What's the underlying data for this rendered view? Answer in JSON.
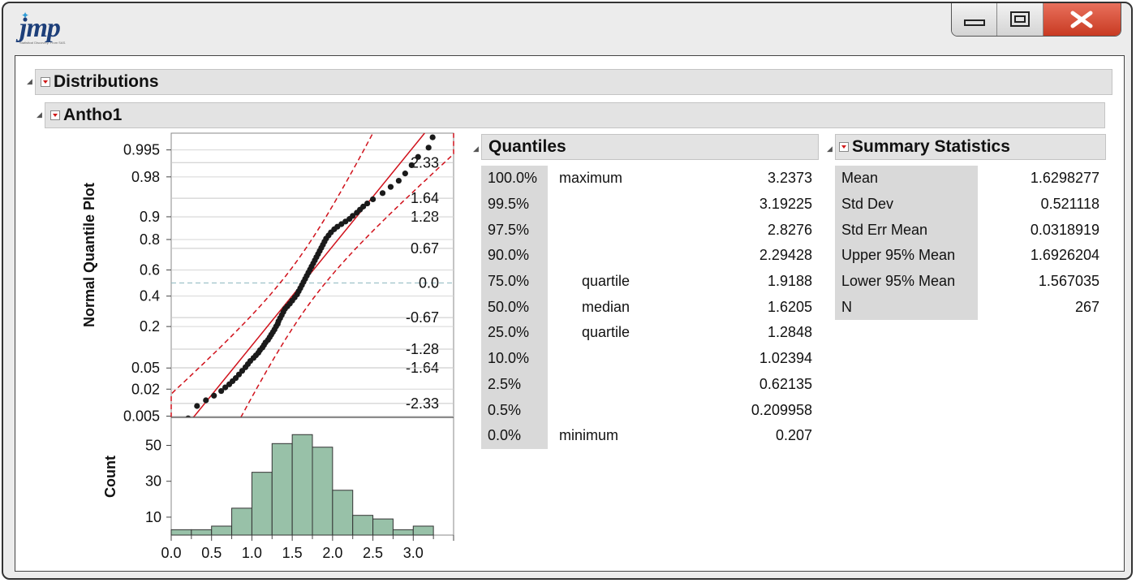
{
  "app": {
    "logo_text": "jmp",
    "logo_subtext": "Statistical Discovery. From SAS."
  },
  "window": {
    "controls": [
      "minimize",
      "maximize",
      "close"
    ]
  },
  "report": {
    "title": "Distributions",
    "variable": "Antho1",
    "quantiles": {
      "title": "Quantiles",
      "rows": [
        {
          "pct": "100.0%",
          "label": "maximum",
          "value": "3.2373"
        },
        {
          "pct": "99.5%",
          "label": "",
          "value": "3.19225"
        },
        {
          "pct": "97.5%",
          "label": "",
          "value": "2.8276"
        },
        {
          "pct": "90.0%",
          "label": "",
          "value": "2.29428"
        },
        {
          "pct": "75.0%",
          "label": "quartile",
          "value": "1.9188"
        },
        {
          "pct": "50.0%",
          "label": "median",
          "value": "1.6205"
        },
        {
          "pct": "25.0%",
          "label": "quartile",
          "value": "1.2848"
        },
        {
          "pct": "10.0%",
          "label": "",
          "value": "1.02394"
        },
        {
          "pct": "2.5%",
          "label": "",
          "value": "0.62135"
        },
        {
          "pct": "0.5%",
          "label": "",
          "value": "0.209958"
        },
        {
          "pct": "0.0%",
          "label": "minimum",
          "value": "0.207"
        }
      ]
    },
    "summary": {
      "title": "Summary Statistics",
      "rows": [
        {
          "label": "Mean",
          "value": "1.6298277"
        },
        {
          "label": "Std Dev",
          "value": "0.521118"
        },
        {
          "label": "Std Err Mean",
          "value": "0.0318919"
        },
        {
          "label": "Upper 95% Mean",
          "value": "1.6926204"
        },
        {
          "label": "Lower 95% Mean",
          "value": "1.567035"
        },
        {
          "label": "N",
          "value": "267"
        }
      ]
    }
  },
  "colors": {
    "bar_fill": "#98c1a8",
    "fit_line": "#d0111b",
    "points": "#1a1a1a",
    "header_bg": "#e3e3e3",
    "label_bg": "#d9d9d9"
  },
  "chart_data": [
    {
      "type": "scatter",
      "title": "",
      "ylabel": "Normal Quantile Plot",
      "left_ticks": [
        "0.995",
        "0.98",
        "0.9",
        "0.8",
        "0.6",
        "0.4",
        "0.2",
        "0.05",
        "0.02",
        "0.005"
      ],
      "right_ticks": [
        "2.33",
        "1.64",
        "1.28",
        "0.67",
        "0.0",
        "-0.67",
        "-1.28",
        "-1.64",
        "-2.33"
      ],
      "right_tick_values": [
        2.33,
        1.64,
        1.28,
        0.67,
        0.0,
        -0.67,
        -1.28,
        -1.64,
        -2.33
      ],
      "ylim": [
        -2.6,
        2.9
      ],
      "xlim": [
        0.0,
        3.5
      ],
      "fit_line": {
        "mean": 1.6298,
        "sd": 0.5211
      },
      "points": [
        [
          0.21,
          -2.62
        ],
        [
          0.32,
          -2.38
        ],
        [
          0.43,
          -2.27
        ],
        [
          0.53,
          -2.18
        ],
        [
          0.62,
          -2.09
        ],
        [
          0.67,
          -2.02
        ],
        [
          0.72,
          -1.96
        ],
        [
          0.76,
          -1.9
        ],
        [
          0.8,
          -1.84
        ],
        [
          0.84,
          -1.77
        ],
        [
          0.88,
          -1.7
        ],
        [
          0.92,
          -1.63
        ],
        [
          0.95,
          -1.57
        ],
        [
          0.98,
          -1.51
        ],
        [
          1.02,
          -1.45
        ],
        [
          1.05,
          -1.4
        ],
        [
          1.08,
          -1.35
        ],
        [
          1.1,
          -1.3
        ],
        [
          1.13,
          -1.25
        ],
        [
          1.15,
          -1.2
        ],
        [
          1.17,
          -1.15
        ],
        [
          1.2,
          -1.1
        ],
        [
          1.22,
          -1.05
        ],
        [
          1.24,
          -1.0
        ],
        [
          1.26,
          -0.95
        ],
        [
          1.28,
          -0.9
        ],
        [
          1.3,
          -0.84
        ],
        [
          1.32,
          -0.79
        ],
        [
          1.33,
          -0.74
        ],
        [
          1.35,
          -0.68
        ],
        [
          1.37,
          -0.62
        ],
        [
          1.39,
          -0.56
        ],
        [
          1.41,
          -0.5
        ],
        [
          1.44,
          -0.45
        ],
        [
          1.47,
          -0.4
        ],
        [
          1.5,
          -0.34
        ],
        [
          1.53,
          -0.28
        ],
        [
          1.56,
          -0.22
        ],
        [
          1.58,
          -0.16
        ],
        [
          1.6,
          -0.1
        ],
        [
          1.62,
          -0.04
        ],
        [
          1.64,
          0.02
        ],
        [
          1.66,
          0.08
        ],
        [
          1.68,
          0.14
        ],
        [
          1.7,
          0.2
        ],
        [
          1.72,
          0.26
        ],
        [
          1.74,
          0.32
        ],
        [
          1.76,
          0.38
        ],
        [
          1.78,
          0.44
        ],
        [
          1.8,
          0.5
        ],
        [
          1.82,
          0.56
        ],
        [
          1.84,
          0.62
        ],
        [
          1.86,
          0.68
        ],
        [
          1.88,
          0.74
        ],
        [
          1.9,
          0.8
        ],
        [
          1.92,
          0.86
        ],
        [
          1.95,
          0.92
        ],
        [
          1.98,
          0.98
        ],
        [
          2.02,
          1.04
        ],
        [
          2.06,
          1.09
        ],
        [
          2.11,
          1.14
        ],
        [
          2.16,
          1.19
        ],
        [
          2.21,
          1.24
        ],
        [
          2.25,
          1.3
        ],
        [
          2.3,
          1.36
        ],
        [
          2.34,
          1.42
        ],
        [
          2.38,
          1.48
        ],
        [
          2.43,
          1.54
        ],
        [
          2.5,
          1.62
        ],
        [
          2.62,
          1.74
        ],
        [
          2.72,
          1.86
        ],
        [
          2.82,
          1.98
        ],
        [
          2.9,
          2.12
        ],
        [
          2.98,
          2.28
        ],
        [
          3.06,
          2.44
        ],
        [
          3.19,
          2.62
        ],
        [
          3.24,
          2.82
        ]
      ]
    },
    {
      "type": "bar",
      "title": "",
      "ylabel": "Count",
      "xlabel": "",
      "bin_edges": [
        0.0,
        0.25,
        0.5,
        0.75,
        1.0,
        1.25,
        1.5,
        1.75,
        2.0,
        2.25,
        2.5,
        2.75,
        3.0,
        3.25
      ],
      "values": [
        3,
        3,
        5,
        15,
        35,
        51,
        56,
        49,
        25,
        11,
        9,
        3,
        5
      ],
      "x_ticks": [
        "0.0",
        "0.5",
        "1.0",
        "1.5",
        "2.0",
        "2.5",
        "3.0"
      ],
      "x_tick_values": [
        0.0,
        0.5,
        1.0,
        1.5,
        2.0,
        2.5,
        3.0
      ],
      "y_ticks": [
        "10",
        "30",
        "50"
      ],
      "y_tick_values": [
        10,
        30,
        50
      ],
      "xlim": [
        0.0,
        3.5
      ],
      "ylim": [
        0,
        62
      ]
    }
  ]
}
